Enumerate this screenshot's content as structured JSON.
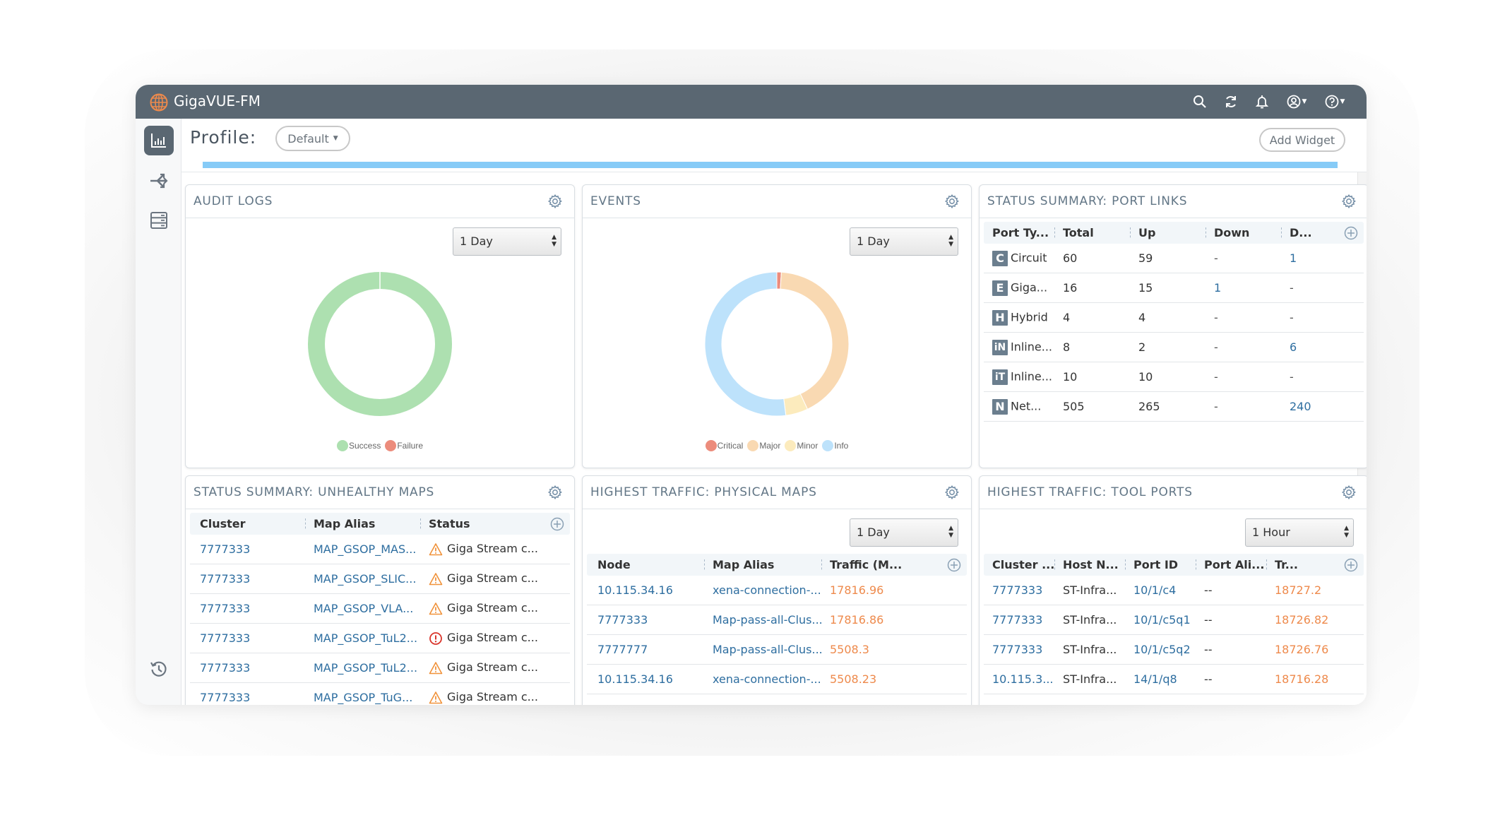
{
  "app": {
    "title": "GigaVUE-FM",
    "brand_color": "#ee8a4c",
    "titlebar_color": "#5a6772"
  },
  "titlebar_icons": [
    "search-icon",
    "refresh-icon",
    "bell-icon",
    "user-icon",
    "help-icon"
  ],
  "sidebar": {
    "items": [
      {
        "name": "dashboard",
        "icon": "bar-chart-icon",
        "active": true
      },
      {
        "name": "traffic",
        "icon": "split-arrows-icon",
        "active": false
      },
      {
        "name": "inventory",
        "icon": "server-icon",
        "active": false
      },
      {
        "name": "history",
        "icon": "history-icon",
        "active": false
      }
    ]
  },
  "toolbar": {
    "profile_label": "Profile:",
    "profile_value": "Default",
    "add_widget_label": "Add Widget",
    "progress": 1.0
  },
  "widgets": {
    "audit_logs": {
      "title": "AUDIT LOGS",
      "range": "1 Day",
      "legend": [
        {
          "label": "Success",
          "color": "#ade0b0"
        },
        {
          "label": "Failure",
          "color": "#ec8c7c"
        }
      ]
    },
    "events": {
      "title": "EVENTS",
      "range": "1 Day",
      "legend": [
        {
          "label": "Critical",
          "color": "#ec8c7c"
        },
        {
          "label": "Major",
          "color": "#f9d9b2"
        },
        {
          "label": "Minor",
          "color": "#fcebbd"
        },
        {
          "label": "Info",
          "color": "#bde2fb"
        }
      ]
    },
    "port_links": {
      "title": "STATUS SUMMARY: PORT LINKS",
      "columns": [
        "Port Ty...",
        "Total",
        "Up",
        "Down",
        "D..."
      ],
      "rows": [
        {
          "badge": "C",
          "type": "Circuit",
          "total": "60",
          "up": "59",
          "down": "-",
          "d": "1"
        },
        {
          "badge": "E",
          "type": "Giga...",
          "total": "16",
          "up": "15",
          "down": "1",
          "d": "-"
        },
        {
          "badge": "H",
          "type": "Hybrid",
          "total": "4",
          "up": "4",
          "down": "-",
          "d": "-"
        },
        {
          "badge": "iN",
          "type": "Inline...",
          "total": "8",
          "up": "2",
          "down": "-",
          "d": "6"
        },
        {
          "badge": "iT",
          "type": "Inline...",
          "total": "10",
          "up": "10",
          "down": "-",
          "d": "-"
        },
        {
          "badge": "N",
          "type": "Net...",
          "total": "505",
          "up": "265",
          "down": "-",
          "d": "240"
        }
      ]
    },
    "unhealthy_maps": {
      "title": "STATUS SUMMARY: UNHEALTHY MAPS",
      "columns": [
        "Cluster",
        "Map Alias",
        "Status"
      ],
      "rows": [
        {
          "cluster": "7777333",
          "alias": "MAP_GSOP_MAS...",
          "status_icon": "warning",
          "status": "Giga Stream c..."
        },
        {
          "cluster": "7777333",
          "alias": "MAP_GSOP_SLIC...",
          "status_icon": "warning",
          "status": "Giga Stream c..."
        },
        {
          "cluster": "7777333",
          "alias": "MAP_GSOP_VLA...",
          "status_icon": "warning",
          "status": "Giga Stream c..."
        },
        {
          "cluster": "7777333",
          "alias": "MAP_GSOP_TuL2...",
          "status_icon": "error",
          "status": "Giga Stream c..."
        },
        {
          "cluster": "7777333",
          "alias": "MAP_GSOP_TuL2...",
          "status_icon": "warning",
          "status": "Giga Stream c..."
        },
        {
          "cluster": "7777333",
          "alias": "MAP_GSOP_TuG...",
          "status_icon": "warning",
          "status": "Giga Stream c..."
        }
      ]
    },
    "physical_maps": {
      "title": "HIGHEST TRAFFIC: PHYSICAL MAPS",
      "range": "1 Day",
      "columns": [
        "Node",
        "Map Alias",
        "Traffic (M..."
      ],
      "rows": [
        {
          "node": "10.115.34.16",
          "alias": "xena-connection-...",
          "traffic": "17816.96"
        },
        {
          "node": "7777333",
          "alias": "Map-pass-all-Clus...",
          "traffic": "17816.86"
        },
        {
          "node": "7777777",
          "alias": "Map-pass-all-Clus...",
          "traffic": "5508.3"
        },
        {
          "node": "10.115.34.16",
          "alias": "xena-connection-...",
          "traffic": "5508.23"
        }
      ]
    },
    "tool_ports": {
      "title": "HIGHEST TRAFFIC: TOOL PORTS",
      "range": "1 Hour",
      "columns": [
        "Cluster ...",
        "Host N...",
        "Port ID",
        "Port Ali...",
        "Tr..."
      ],
      "rows": [
        {
          "cluster": "7777333",
          "host": "ST-Infra...",
          "port": "10/1/c4",
          "alias": "--",
          "traffic": "18727.2"
        },
        {
          "cluster": "7777333",
          "host": "ST-Infra...",
          "port": "10/1/c5q1",
          "alias": "--",
          "traffic": "18726.82"
        },
        {
          "cluster": "7777333",
          "host": "ST-Infra...",
          "port": "10/1/c5q2",
          "alias": "--",
          "traffic": "18726.76"
        },
        {
          "cluster": "10.115.3...",
          "host": "ST-Infra...",
          "port": "14/1/q8",
          "alias": "--",
          "traffic": "18716.28"
        }
      ]
    }
  },
  "chart_data": [
    {
      "type": "pie",
      "title": "AUDIT LOGS",
      "categories": [
        "Success",
        "Failure"
      ],
      "values": [
        100,
        0
      ],
      "colors": [
        "#ade0b0",
        "#ec8c7c"
      ],
      "legend": "bottom"
    },
    {
      "type": "pie",
      "title": "EVENTS",
      "categories": [
        "Critical",
        "Major",
        "Minor",
        "Info"
      ],
      "values": [
        1,
        42,
        5,
        52
      ],
      "colors": [
        "#ec8c7c",
        "#f9d9b2",
        "#fcebbd",
        "#bde2fb"
      ],
      "legend": "bottom"
    }
  ]
}
